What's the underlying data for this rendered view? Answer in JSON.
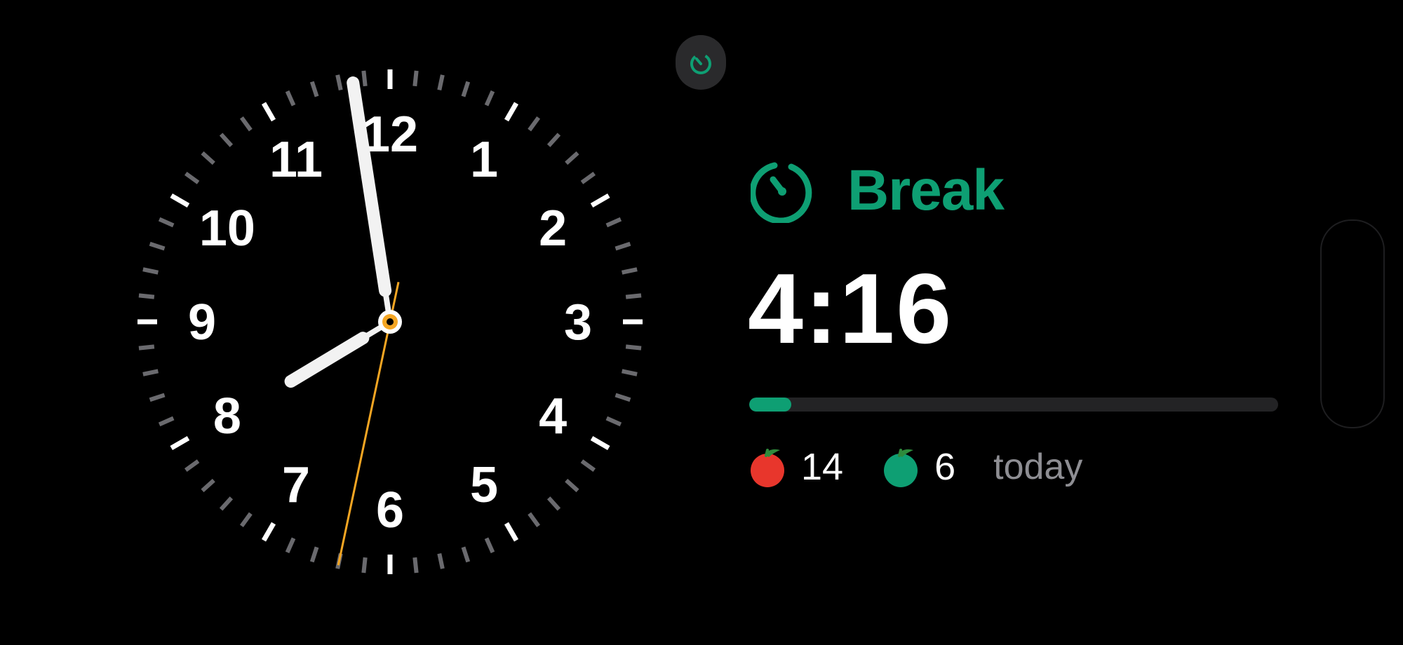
{
  "clock": {
    "numerals": [
      "12",
      "1",
      "2",
      "3",
      "4",
      "5",
      "6",
      "7",
      "8",
      "9",
      "10",
      "11"
    ],
    "time_shown": {
      "hours": 7,
      "minutes": 58,
      "seconds": 32
    },
    "hand_color": "#f2f2f2",
    "second_hand_color": "#f5a623"
  },
  "status_indicator": {
    "icon": "timer-icon",
    "color": "#0e9f73"
  },
  "pomodoro": {
    "mode_icon": "timer-icon",
    "mode": "Break",
    "remaining": "4:16",
    "progress": 0.08,
    "accent_color": "#0e9f73",
    "stats": {
      "red_tomato_icon": "red-tomato-icon",
      "red_count": "14",
      "green_tomato_icon": "green-tomato-icon",
      "green_count": "6",
      "period": "today"
    }
  }
}
